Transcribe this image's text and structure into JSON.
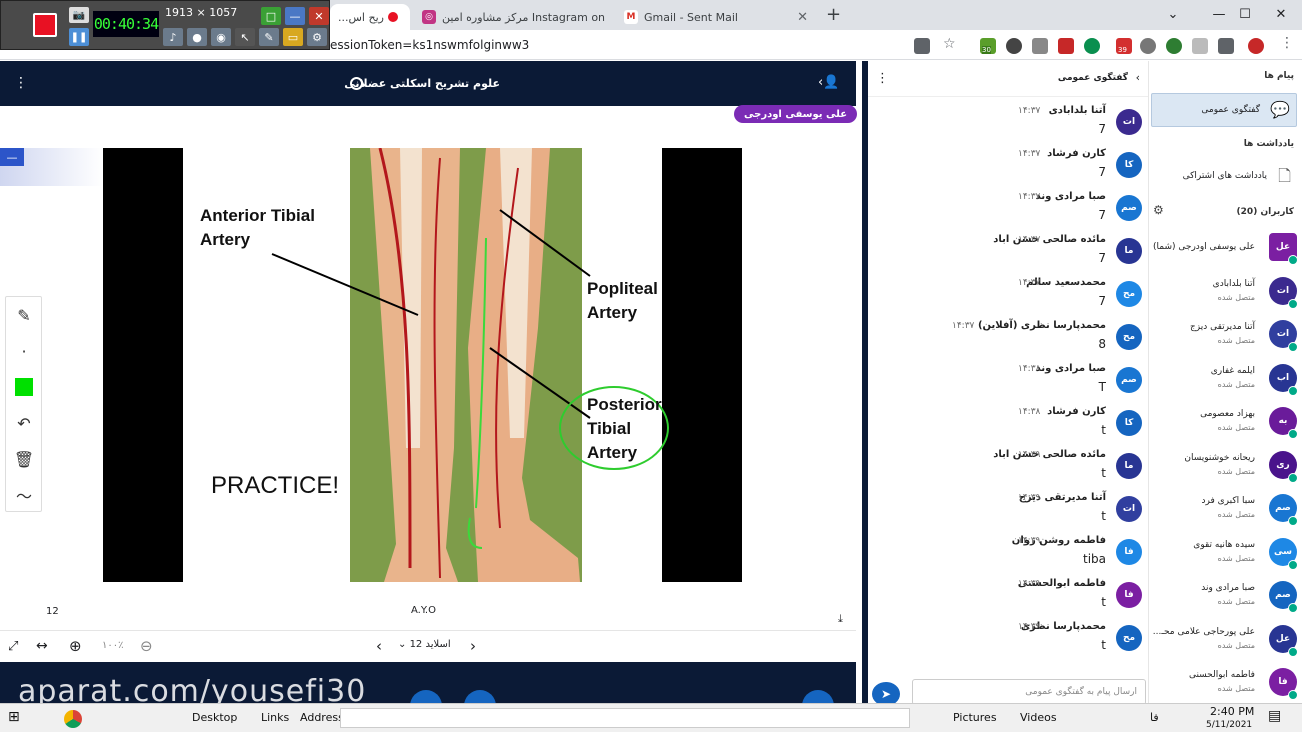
{
  "recorder": {
    "time": "00:40:34",
    "resolution": "1913 × 1057"
  },
  "tabs": [
    {
      "label": "...ریح اس",
      "active": true
    },
    {
      "label": "مرکز مشاوره امین Instagram on",
      "active": false
    },
    {
      "label": "Gmail - Sent Mail",
      "active": false
    }
  ],
  "address": {
    "url": "essionToken=ks1nswmfolginww3"
  },
  "extensions": {
    "badge1": "30",
    "badge2": "39"
  },
  "meeting": {
    "title": "علوم تشریح اسکلتی عضلانی",
    "presenter": "علی یوسفی اودرجی"
  },
  "slide": {
    "label_anterior": "Anterior Tibial\nArtery",
    "label_popliteal": "Popliteal\nArtery",
    "label_posterior": "Posterior\nTibial\nArtery",
    "practice": "PRACTICE!",
    "page_left": "12",
    "footer_center": "A.Y.O"
  },
  "controls": {
    "zoom": "۱۰۰٪",
    "slide_label": "اسلاید 12"
  },
  "watermark": "aparat.com/yousefi30",
  "chat": {
    "title": "گفتگوی عمومی",
    "input_placeholder": "ارسال پیام به گفتگوی عمومی",
    "messages": [
      {
        "initials": "ات",
        "name": "آتنا بلدابادی",
        "time": "۱۴:۳۷",
        "text": "7",
        "color": "#3b2a8f"
      },
      {
        "initials": "کا",
        "name": "کارن فرشاد",
        "time": "۱۴:۳۷",
        "text": "7",
        "color": "#1565c0"
      },
      {
        "initials": "صم",
        "name": "صبا مرادی وند",
        "time": "۱۴:۳۷",
        "text": "7",
        "color": "#1976d2"
      },
      {
        "initials": "ما",
        "name": "مائده صالحی حسن اباد",
        "time": "۱۴:۳۷",
        "text": "7",
        "color": "#283593"
      },
      {
        "initials": "مح",
        "name": "محمدسعید سالم",
        "time": "۱۴:۳۷",
        "text": "7",
        "color": "#1e88e5"
      },
      {
        "initials": "مح",
        "name": "محمدپارسا نظری (آفلاین)",
        "time": "۱۴:۳۷",
        "text": "8",
        "color": "#1565c0"
      },
      {
        "initials": "صم",
        "name": "صبا مرادی وند",
        "time": "۱۴:۳۸",
        "text": "T",
        "color": "#1976d2"
      },
      {
        "initials": "کا",
        "name": "کارن فرشاد",
        "time": "۱۴:۳۸",
        "text": "t",
        "color": "#1565c0"
      },
      {
        "initials": "ما",
        "name": "مائده صالحی حسن اباد",
        "time": "۱۴:۳۹",
        "text": "t",
        "color": "#283593"
      },
      {
        "initials": "ات",
        "name": "آتنا مدیرتقی دیزج",
        "time": "۱۴:۳۹",
        "text": "t",
        "color": "#303f9f"
      },
      {
        "initials": "فا",
        "name": "فاطمه روشن روان",
        "time": "۱۴:۳۹",
        "text": "tiba",
        "color": "#1e88e5"
      },
      {
        "initials": "فا",
        "name": "فاطمه ابوالحسنی",
        "time": "۱۴:۳۹",
        "text": "t",
        "color": "#7b1fa2"
      },
      {
        "initials": "مح",
        "name": "محمدپارسا نظری",
        "time": "۱۴:۳۹",
        "text": "t",
        "color": "#1565c0"
      }
    ]
  },
  "sidebar": {
    "messages_header": "پیام ها",
    "public_chat": "گفتگوی عمومی",
    "notes_header": "یادداشت ها",
    "shared_notes": "یادداشت های اشتراکی",
    "users_header": "کاربران (20)",
    "users": [
      {
        "initials": "عل",
        "name": "علی یوسفی اودرجی (شما)",
        "status": "",
        "color": "#7b1fa2"
      },
      {
        "initials": "ات",
        "name": "آتنا بلدابادی",
        "status": "متصل شده",
        "color": "#3b2a8f"
      },
      {
        "initials": "ات",
        "name": "آتنا مدیرتقی دیزج",
        "status": "متصل شده",
        "color": "#303f9f"
      },
      {
        "initials": "اب",
        "name": "ایلمه غفاری",
        "status": "متصل شده",
        "color": "#283593"
      },
      {
        "initials": "به",
        "name": "بهزاد معصومی",
        "status": "متصل شده",
        "color": "#6a1b9a"
      },
      {
        "initials": "ری",
        "name": "ریحانه خوشنویسان",
        "status": "متصل شده",
        "color": "#4a148c"
      },
      {
        "initials": "صم",
        "name": "سبا اکبری فرد",
        "status": "متصل شده",
        "color": "#1976d2"
      },
      {
        "initials": "سی",
        "name": "سیده هانیه تقوی",
        "status": "متصل شده",
        "color": "#1e88e5"
      },
      {
        "initials": "صم",
        "name": "صبا مرادی وند",
        "status": "متصل شده",
        "color": "#1565c0"
      },
      {
        "initials": "عل",
        "name": "علی پورحاجی علامی محـ...",
        "status": "متصل شده",
        "color": "#283593"
      },
      {
        "initials": "فا",
        "name": "فاطمه ابوالحسنی",
        "status": "متصل شده",
        "color": "#7b1fa2"
      }
    ]
  },
  "taskbar": {
    "desktop": "Desktop",
    "links": "Links",
    "address": "Address",
    "pictures": "Pictures",
    "videos": "Videos",
    "lang": "فا",
    "time": "2:40 PM",
    "date": "5/11/2021"
  }
}
